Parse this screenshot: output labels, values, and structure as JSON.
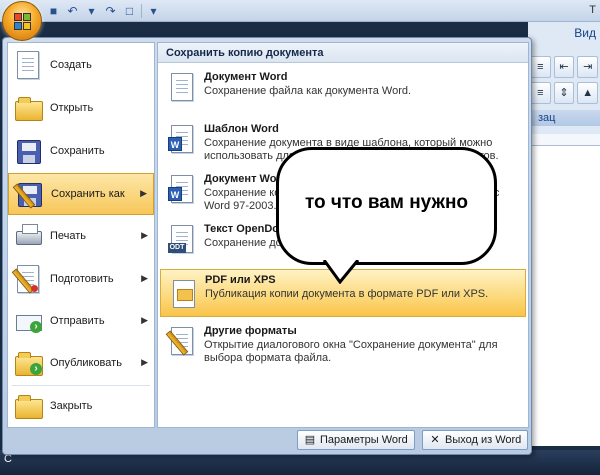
{
  "window": {
    "caption_fragment": "Т",
    "ribbon_tab_fragment": "Вид",
    "ribbon_group_fragment": "зац",
    "status_fragment": "С"
  },
  "menu": {
    "left_items": [
      {
        "label": "Создать",
        "icon": "new-document-icon",
        "has_submenu": false
      },
      {
        "label": "Открыть",
        "icon": "open-folder-icon",
        "has_submenu": false
      },
      {
        "label": "Сохранить",
        "icon": "save-icon",
        "has_submenu": false
      },
      {
        "label": "Сохранить как",
        "icon": "save-as-icon",
        "has_submenu": true,
        "active": true
      },
      {
        "label": "Печать",
        "icon": "print-icon",
        "has_submenu": true
      },
      {
        "label": "Подготовить",
        "icon": "prepare-icon",
        "has_submenu": true
      },
      {
        "label": "Отправить",
        "icon": "send-icon",
        "has_submenu": true
      },
      {
        "label": "Опубликовать",
        "icon": "publish-icon",
        "has_submenu": true
      },
      {
        "label": "Закрыть",
        "icon": "close-folder-icon",
        "has_submenu": false
      }
    ],
    "right_header": "Сохранить копию документа",
    "options": [
      {
        "title": "Документ Word",
        "description": "Сохранение файла как документа Word.",
        "icon": "word-document-icon"
      },
      {
        "title": "Шаблон Word",
        "description": "Сохранение документа в виде шаблона, который можно использовать для форматирования будущих документов.",
        "icon": "word-template-icon"
      },
      {
        "title": "Документ Word 97-2003",
        "description": "Сохранение копии документа, полностью совместимого с Word 97-2003.",
        "icon": "word-97-icon"
      },
      {
        "title": "Текст OpenDocument",
        "description": "Сохранение документа в формате OpenDocument.",
        "icon": "odt-icon"
      },
      {
        "title": "PDF или XPS",
        "description": "Публикация копии документа в формате PDF или XPS.",
        "icon": "pdf-xps-icon",
        "active": true
      },
      {
        "title": "Другие форматы",
        "description": "Открытие диалогового окна \"Сохранение документа\" для выбора формата файла.",
        "icon": "other-formats-icon"
      }
    ],
    "bottom_buttons": {
      "options_label": "Параметры Word",
      "exit_label": "Выход из Word"
    }
  },
  "annotation": {
    "bubble_text": "то что вам нужно"
  }
}
